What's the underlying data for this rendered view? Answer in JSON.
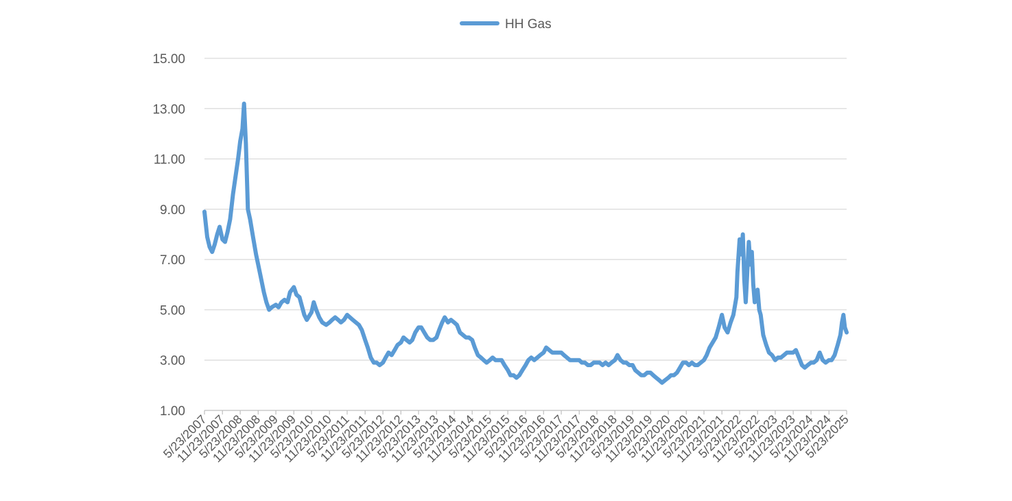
{
  "chart_data": {
    "type": "line",
    "title": "",
    "xlabel": "",
    "ylabel": "",
    "ylim": [
      1.0,
      15.0
    ],
    "yticks": [
      "1.00",
      "3.00",
      "5.00",
      "7.00",
      "9.00",
      "11.00",
      "13.00",
      "15.00"
    ],
    "grid": true,
    "legend_position": "top-center",
    "x_tick_labels": [
      "5/23/2007",
      "11/23/2007",
      "5/23/2008",
      "11/23/2008",
      "5/23/2009",
      "11/23/2009",
      "5/23/2010",
      "11/23/2010",
      "5/23/2011",
      "11/23/2011",
      "5/23/2012",
      "11/23/2012",
      "5/23/2013",
      "11/23/2013",
      "5/23/2014",
      "11/23/2014",
      "5/23/2015",
      "11/23/2015",
      "5/23/2016",
      "11/23/2016",
      "5/23/2017",
      "11/23/2017",
      "5/23/2018",
      "11/23/2018",
      "5/23/2019",
      "11/23/2019",
      "5/23/2020",
      "11/23/2020",
      "5/23/2021",
      "11/23/2021",
      "5/23/2022",
      "11/23/2022",
      "5/23/2023",
      "11/23/2023",
      "5/23/2024",
      "11/23/2024",
      "5/23/2025"
    ],
    "series": [
      {
        "name": "HH Gas",
        "color": "#5b9bd5",
        "points": [
          [
            "2007-05-23",
            8.9
          ],
          [
            "2007-06-20",
            7.9
          ],
          [
            "2007-07-15",
            7.5
          ],
          [
            "2007-08-10",
            7.3
          ],
          [
            "2007-09-05",
            7.6
          ],
          [
            "2007-10-01",
            8.0
          ],
          [
            "2007-10-25",
            8.3
          ],
          [
            "2007-11-23",
            7.8
          ],
          [
            "2007-12-20",
            7.7
          ],
          [
            "2008-01-15",
            8.1
          ],
          [
            "2008-02-10",
            8.6
          ],
          [
            "2008-03-10",
            9.6
          ],
          [
            "2008-04-05",
            10.3
          ],
          [
            "2008-05-01",
            11.0
          ],
          [
            "2008-05-23",
            11.7
          ],
          [
            "2008-06-15",
            12.2
          ],
          [
            "2008-07-01",
            13.2
          ],
          [
            "2008-07-20",
            11.6
          ],
          [
            "2008-08-10",
            9.0
          ],
          [
            "2008-09-01",
            8.6
          ],
          [
            "2008-10-01",
            7.9
          ],
          [
            "2008-11-01",
            7.2
          ],
          [
            "2008-11-23",
            6.8
          ],
          [
            "2008-12-20",
            6.3
          ],
          [
            "2009-01-20",
            5.7
          ],
          [
            "2009-02-15",
            5.3
          ],
          [
            "2009-03-15",
            5.0
          ],
          [
            "2009-04-10",
            5.1
          ],
          [
            "2009-05-23",
            5.2
          ],
          [
            "2009-06-20",
            5.1
          ],
          [
            "2009-07-20",
            5.3
          ],
          [
            "2009-08-20",
            5.4
          ],
          [
            "2009-09-20",
            5.3
          ],
          [
            "2009-10-15",
            5.7
          ],
          [
            "2009-11-23",
            5.9
          ],
          [
            "2009-12-20",
            5.6
          ],
          [
            "2010-01-20",
            5.5
          ],
          [
            "2010-02-10",
            5.2
          ],
          [
            "2010-03-10",
            4.8
          ],
          [
            "2010-04-05",
            4.6
          ],
          [
            "2010-05-23",
            4.9
          ],
          [
            "2010-06-15",
            5.3
          ],
          [
            "2010-07-10",
            5.0
          ],
          [
            "2010-08-10",
            4.7
          ],
          [
            "2010-09-10",
            4.5
          ],
          [
            "2010-10-20",
            4.4
          ],
          [
            "2010-11-23",
            4.5
          ],
          [
            "2010-12-20",
            4.6
          ],
          [
            "2011-01-20",
            4.7
          ],
          [
            "2011-02-20",
            4.6
          ],
          [
            "2011-03-20",
            4.5
          ],
          [
            "2011-04-20",
            4.6
          ],
          [
            "2011-05-23",
            4.8
          ],
          [
            "2011-06-20",
            4.7
          ],
          [
            "2011-07-20",
            4.6
          ],
          [
            "2011-08-20",
            4.5
          ],
          [
            "2011-09-20",
            4.4
          ],
          [
            "2011-10-20",
            4.2
          ],
          [
            "2011-11-23",
            3.8
          ],
          [
            "2011-12-20",
            3.5
          ],
          [
            "2012-01-20",
            3.1
          ],
          [
            "2012-02-20",
            2.9
          ],
          [
            "2012-03-20",
            2.9
          ],
          [
            "2012-04-20",
            2.8
          ],
          [
            "2012-05-23",
            2.9
          ],
          [
            "2012-06-20",
            3.1
          ],
          [
            "2012-07-20",
            3.3
          ],
          [
            "2012-08-20",
            3.2
          ],
          [
            "2012-09-20",
            3.4
          ],
          [
            "2012-10-20",
            3.6
          ],
          [
            "2012-11-23",
            3.7
          ],
          [
            "2012-12-20",
            3.9
          ],
          [
            "2013-01-20",
            3.8
          ],
          [
            "2013-02-20",
            3.7
          ],
          [
            "2013-03-20",
            3.8
          ],
          [
            "2013-04-20",
            4.1
          ],
          [
            "2013-05-23",
            4.3
          ],
          [
            "2013-06-20",
            4.3
          ],
          [
            "2013-07-20",
            4.1
          ],
          [
            "2013-08-20",
            3.9
          ],
          [
            "2013-09-20",
            3.8
          ],
          [
            "2013-10-20",
            3.8
          ],
          [
            "2013-11-23",
            3.9
          ],
          [
            "2013-12-20",
            4.2
          ],
          [
            "2014-01-20",
            4.5
          ],
          [
            "2014-02-15",
            4.7
          ],
          [
            "2014-03-20",
            4.5
          ],
          [
            "2014-04-20",
            4.6
          ],
          [
            "2014-05-23",
            4.5
          ],
          [
            "2014-06-20",
            4.4
          ],
          [
            "2014-07-20",
            4.1
          ],
          [
            "2014-08-20",
            4.0
          ],
          [
            "2014-09-20",
            3.9
          ],
          [
            "2014-10-20",
            3.9
          ],
          [
            "2014-11-23",
            3.8
          ],
          [
            "2014-12-20",
            3.5
          ],
          [
            "2015-01-20",
            3.2
          ],
          [
            "2015-02-20",
            3.1
          ],
          [
            "2015-03-20",
            3.0
          ],
          [
            "2015-04-20",
            2.9
          ],
          [
            "2015-05-23",
            3.0
          ],
          [
            "2015-06-20",
            3.1
          ],
          [
            "2015-07-20",
            3.0
          ],
          [
            "2015-08-20",
            3.0
          ],
          [
            "2015-09-20",
            3.0
          ],
          [
            "2015-10-20",
            2.8
          ],
          [
            "2015-11-23",
            2.6
          ],
          [
            "2015-12-20",
            2.4
          ],
          [
            "2016-01-20",
            2.4
          ],
          [
            "2016-02-20",
            2.3
          ],
          [
            "2016-03-20",
            2.4
          ],
          [
            "2016-04-20",
            2.6
          ],
          [
            "2016-05-23",
            2.8
          ],
          [
            "2016-06-20",
            3.0
          ],
          [
            "2016-07-20",
            3.1
          ],
          [
            "2016-08-20",
            3.0
          ],
          [
            "2016-09-20",
            3.1
          ],
          [
            "2016-10-20",
            3.2
          ],
          [
            "2016-11-23",
            3.3
          ],
          [
            "2016-12-20",
            3.5
          ],
          [
            "2017-01-20",
            3.4
          ],
          [
            "2017-02-20",
            3.3
          ],
          [
            "2017-03-20",
            3.3
          ],
          [
            "2017-04-20",
            3.3
          ],
          [
            "2017-05-23",
            3.3
          ],
          [
            "2017-06-20",
            3.2
          ],
          [
            "2017-07-20",
            3.1
          ],
          [
            "2017-08-20",
            3.0
          ],
          [
            "2017-09-20",
            3.0
          ],
          [
            "2017-10-20",
            3.0
          ],
          [
            "2017-11-23",
            3.0
          ],
          [
            "2017-12-20",
            2.9
          ],
          [
            "2018-01-20",
            2.9
          ],
          [
            "2018-02-20",
            2.8
          ],
          [
            "2018-03-20",
            2.8
          ],
          [
            "2018-04-20",
            2.9
          ],
          [
            "2018-05-23",
            2.9
          ],
          [
            "2018-06-20",
            2.9
          ],
          [
            "2018-07-20",
            2.8
          ],
          [
            "2018-08-20",
            2.9
          ],
          [
            "2018-09-20",
            2.8
          ],
          [
            "2018-10-20",
            2.9
          ],
          [
            "2018-11-23",
            3.0
          ],
          [
            "2018-12-20",
            3.2
          ],
          [
            "2019-01-20",
            3.0
          ],
          [
            "2019-02-20",
            2.9
          ],
          [
            "2019-03-20",
            2.9
          ],
          [
            "2019-04-20",
            2.8
          ],
          [
            "2019-05-23",
            2.8
          ],
          [
            "2019-06-20",
            2.6
          ],
          [
            "2019-07-20",
            2.5
          ],
          [
            "2019-08-20",
            2.4
          ],
          [
            "2019-09-20",
            2.4
          ],
          [
            "2019-10-20",
            2.5
          ],
          [
            "2019-11-23",
            2.5
          ],
          [
            "2019-12-20",
            2.4
          ],
          [
            "2020-01-20",
            2.3
          ],
          [
            "2020-02-20",
            2.2
          ],
          [
            "2020-03-20",
            2.1
          ],
          [
            "2020-04-20",
            2.2
          ],
          [
            "2020-05-23",
            2.3
          ],
          [
            "2020-06-20",
            2.4
          ],
          [
            "2020-07-20",
            2.4
          ],
          [
            "2020-08-20",
            2.5
          ],
          [
            "2020-09-20",
            2.7
          ],
          [
            "2020-10-20",
            2.9
          ],
          [
            "2020-11-23",
            2.9
          ],
          [
            "2020-12-20",
            2.8
          ],
          [
            "2021-01-20",
            2.9
          ],
          [
            "2021-02-20",
            2.8
          ],
          [
            "2021-03-20",
            2.8
          ],
          [
            "2021-04-20",
            2.9
          ],
          [
            "2021-05-23",
            3.0
          ],
          [
            "2021-06-20",
            3.2
          ],
          [
            "2021-07-20",
            3.5
          ],
          [
            "2021-08-20",
            3.7
          ],
          [
            "2021-09-20",
            3.9
          ],
          [
            "2021-10-20",
            4.3
          ],
          [
            "2021-11-23",
            4.8
          ],
          [
            "2021-12-20",
            4.3
          ],
          [
            "2022-01-20",
            4.1
          ],
          [
            "2022-02-20",
            4.5
          ],
          [
            "2022-03-20",
            4.8
          ],
          [
            "2022-04-20",
            5.5
          ],
          [
            "2022-05-01",
            6.5
          ],
          [
            "2022-05-23",
            7.8
          ],
          [
            "2022-06-10",
            7.2
          ],
          [
            "2022-06-25",
            8.0
          ],
          [
            "2022-07-10",
            6.2
          ],
          [
            "2022-07-25",
            5.3
          ],
          [
            "2022-08-10",
            6.5
          ],
          [
            "2022-08-25",
            7.7
          ],
          [
            "2022-09-10",
            6.8
          ],
          [
            "2022-09-25",
            7.3
          ],
          [
            "2022-10-10",
            6.0
          ],
          [
            "2022-10-25",
            5.3
          ],
          [
            "2022-11-10",
            5.6
          ],
          [
            "2022-11-23",
            5.8
          ],
          [
            "2022-12-10",
            5.0
          ],
          [
            "2022-12-25",
            4.8
          ],
          [
            "2023-01-20",
            4.0
          ],
          [
            "2023-02-20",
            3.6
          ],
          [
            "2023-03-20",
            3.3
          ],
          [
            "2023-04-20",
            3.2
          ],
          [
            "2023-05-23",
            3.0
          ],
          [
            "2023-06-20",
            3.1
          ],
          [
            "2023-07-20",
            3.1
          ],
          [
            "2023-08-20",
            3.2
          ],
          [
            "2023-09-20",
            3.3
          ],
          [
            "2023-10-20",
            3.3
          ],
          [
            "2023-11-23",
            3.3
          ],
          [
            "2023-12-20",
            3.4
          ],
          [
            "2024-01-20",
            3.1
          ],
          [
            "2024-02-20",
            2.8
          ],
          [
            "2024-03-20",
            2.7
          ],
          [
            "2024-04-20",
            2.8
          ],
          [
            "2024-05-23",
            2.9
          ],
          [
            "2024-06-20",
            2.9
          ],
          [
            "2024-07-20",
            3.0
          ],
          [
            "2024-08-20",
            3.3
          ],
          [
            "2024-09-20",
            3.0
          ],
          [
            "2024-10-20",
            2.9
          ],
          [
            "2024-11-23",
            3.0
          ],
          [
            "2024-12-20",
            3.0
          ],
          [
            "2025-01-20",
            3.2
          ],
          [
            "2025-02-20",
            3.6
          ],
          [
            "2025-03-20",
            4.0
          ],
          [
            "2025-04-05",
            4.5
          ],
          [
            "2025-04-20",
            4.8
          ],
          [
            "2025-05-05",
            4.3
          ],
          [
            "2025-05-23",
            4.1
          ]
        ]
      }
    ]
  }
}
